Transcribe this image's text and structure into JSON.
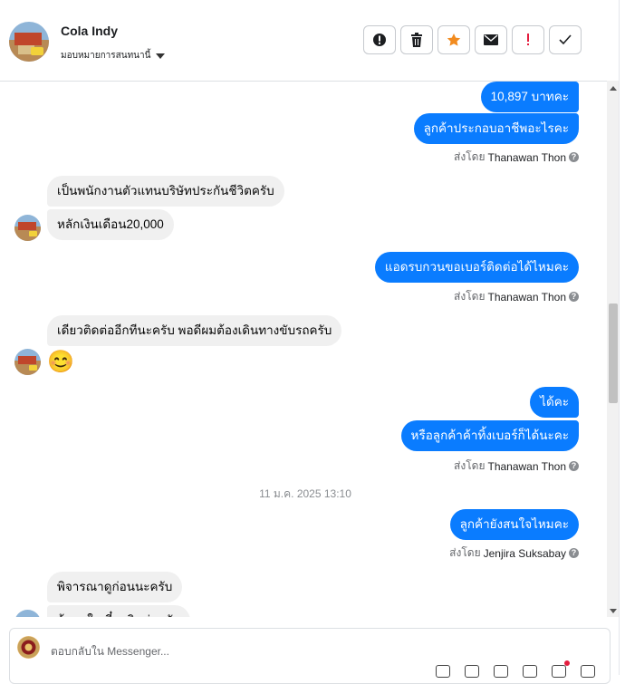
{
  "header": {
    "contact_name": "Cola Indy",
    "assign_label": "มอบหมายการสนทนานี้",
    "actions": [
      {
        "name": "report-button",
        "icon": "alert-circle-icon",
        "color": "#1c1e21"
      },
      {
        "name": "delete-button",
        "icon": "trash-icon",
        "color": "#1c1e21"
      },
      {
        "name": "star-button",
        "icon": "star-icon",
        "color": "#f28b1f"
      },
      {
        "name": "mark-unread-button",
        "icon": "envelope-icon",
        "color": "#1c1e21"
      },
      {
        "name": "follow-up-button",
        "icon": "exclamation-icon",
        "color": "#e41e3f"
      },
      {
        "name": "mark-done-button",
        "icon": "checkmark-icon",
        "color": "#1c1e21"
      }
    ]
  },
  "messages": {
    "out_1": "10,897 บาทคะ",
    "out_2": "ลูกค้าประกอบอาชีพอะไรคะ",
    "sent_prefix": "ส่งโดย",
    "sent_1": "Thanawan Thon",
    "in_1": "เป็นพนักงานตัวแทนบริษัทประกันชีวิตครับ",
    "in_2": "หลักเงินเดือน20,000",
    "out_3": "แอดรบกวนขอเบอร์ติดต่อได้ไหมคะ",
    "sent_2": "Thanawan Thon",
    "in_3": "เดียวติดต่ออีกทีนะครับ พอดีผมต้องเดินทางขับรถครับ",
    "in_4_emoji": "😊",
    "out_4": "ได้คะ",
    "out_5": "หรือลูกค้าค้าทิ้งเบอร์ก็ได้นะคะ",
    "sent_3": "Thanawan Thon",
    "timestamp": "11 ม.ค. 2025 13:10",
    "out_6": "ลูกค้ายังสนใจไหมคะ",
    "sent_4": "Jenjira Suksabay",
    "in_5": "พิจารณาดูก่อนนะครับ",
    "in_6": "ถ้าสนใจเดี๋ยวติดต่อกลับ"
  },
  "composer": {
    "placeholder": "ตอบกลับใน Messenger..."
  },
  "colors": {
    "outgoing_bubble": "#0a7cff",
    "incoming_bubble": "#f0f0f0",
    "star": "#f28b1f",
    "alert": "#e41e3f"
  }
}
